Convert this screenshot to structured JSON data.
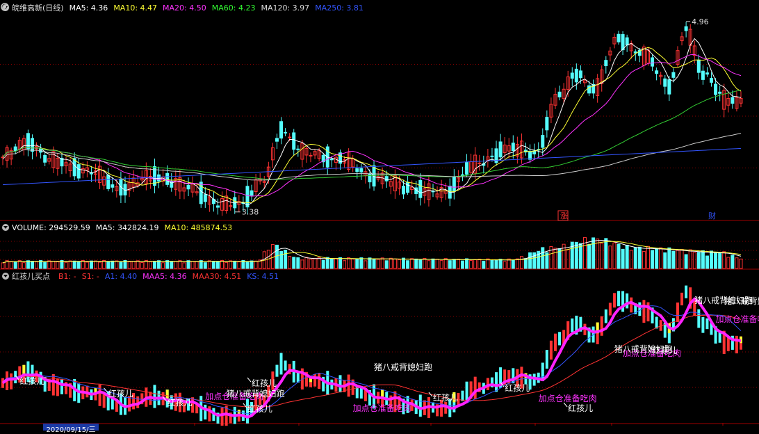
{
  "header": {
    "stock_name": "皖维高新(日线)",
    "ma_legend": [
      {
        "label": "MA5:",
        "value": "4.36",
        "color": "#ffffff"
      },
      {
        "label": "MA10:",
        "value": "4.47",
        "color": "#ffff33"
      },
      {
        "label": "MA20:",
        "value": "4.50",
        "color": "#ff33ff"
      },
      {
        "label": "MA60:",
        "value": "4.23",
        "color": "#33ff33"
      },
      {
        "label": "MA120:",
        "value": "3.97",
        "color": "#dddddd"
      },
      {
        "label": "MA250:",
        "value": "3.81",
        "color": "#3355ff"
      }
    ],
    "high_label": "4.96",
    "low_label": "3.38",
    "tag_zhang": "涨",
    "tag_cai": "财"
  },
  "volume": {
    "legend": [
      {
        "label": "VOLUME:",
        "value": "294529.59",
        "color": "#ffffff"
      },
      {
        "label": "MA5:",
        "value": "342824.19",
        "color": "#ffffff"
      },
      {
        "label": "MA10:",
        "value": "485874.53",
        "color": "#ffff33"
      }
    ]
  },
  "indicator": {
    "name": "红孩儿买点",
    "legend": [
      {
        "label": "B1:",
        "value": "-",
        "color": "#ff3333"
      },
      {
        "label": "S1:",
        "value": "-",
        "color": "#ff3333"
      },
      {
        "label": "A1:",
        "value": "4.40",
        "color": "#3355ff"
      },
      {
        "label": "MAA5:",
        "value": "4.36",
        "color": "#ff33ff"
      },
      {
        "label": "MAA30:",
        "value": "4.51",
        "color": "#ff3333"
      },
      {
        "label": "KS:",
        "value": "4.51",
        "color": "#3355ff"
      }
    ],
    "annotations": [
      {
        "text": "红孩儿",
        "color": "#ffffff",
        "kind": "buy"
      },
      {
        "text": "红孩儿",
        "color": "#ffffff",
        "kind": "buy"
      },
      {
        "text": "红孩儿",
        "color": "#ffffff",
        "kind": "buy"
      },
      {
        "text": "红孩儿",
        "color": "#ffffff",
        "kind": "buy"
      },
      {
        "text": "红孩儿",
        "color": "#ffffff",
        "kind": "buy"
      },
      {
        "text": "红孩儿",
        "color": "#ffffff",
        "kind": "buy"
      },
      {
        "text": "红孩儿",
        "color": "#ffffff",
        "kind": "buy"
      },
      {
        "text": "红孩儿",
        "color": "#ffffff",
        "kind": "buy"
      },
      {
        "text": "红孩儿",
        "color": "#ffffff",
        "kind": "buy"
      },
      {
        "text": "加点仓准备吃肉",
        "color": "#ff33ff",
        "kind": "add"
      },
      {
        "text": "加点仓准备吃肉",
        "color": "#ff33ff",
        "kind": "add"
      },
      {
        "text": "加点仓准备吃肉",
        "color": "#ff33ff",
        "kind": "add"
      },
      {
        "text": "加点仓准备吃肉",
        "color": "#ff33ff",
        "kind": "add"
      },
      {
        "text": "加点仓准备吃肉",
        "color": "#ff33ff",
        "kind": "add"
      },
      {
        "text": "猪八戒背媳妇跑",
        "color": "#ffffff",
        "kind": "sell"
      },
      {
        "text": "猪八戒背媳妇跑",
        "color": "#ffffff",
        "kind": "sell"
      },
      {
        "text": "猪八戒背媳妇跑",
        "color": "#ffffff",
        "kind": "sell"
      },
      {
        "text": "猪八戒背媳妇跑",
        "color": "#ffffff",
        "kind": "sell"
      },
      {
        "text": "猪八戒背媳妇跑",
        "color": "#ffffff",
        "kind": "sell"
      }
    ]
  },
  "axis": {
    "date_label": "2020/09/15/三"
  },
  "colors": {
    "up": "#ff3333",
    "down": "#54fcfc",
    "background": "#000000",
    "grid": "#8b0000"
  }
}
